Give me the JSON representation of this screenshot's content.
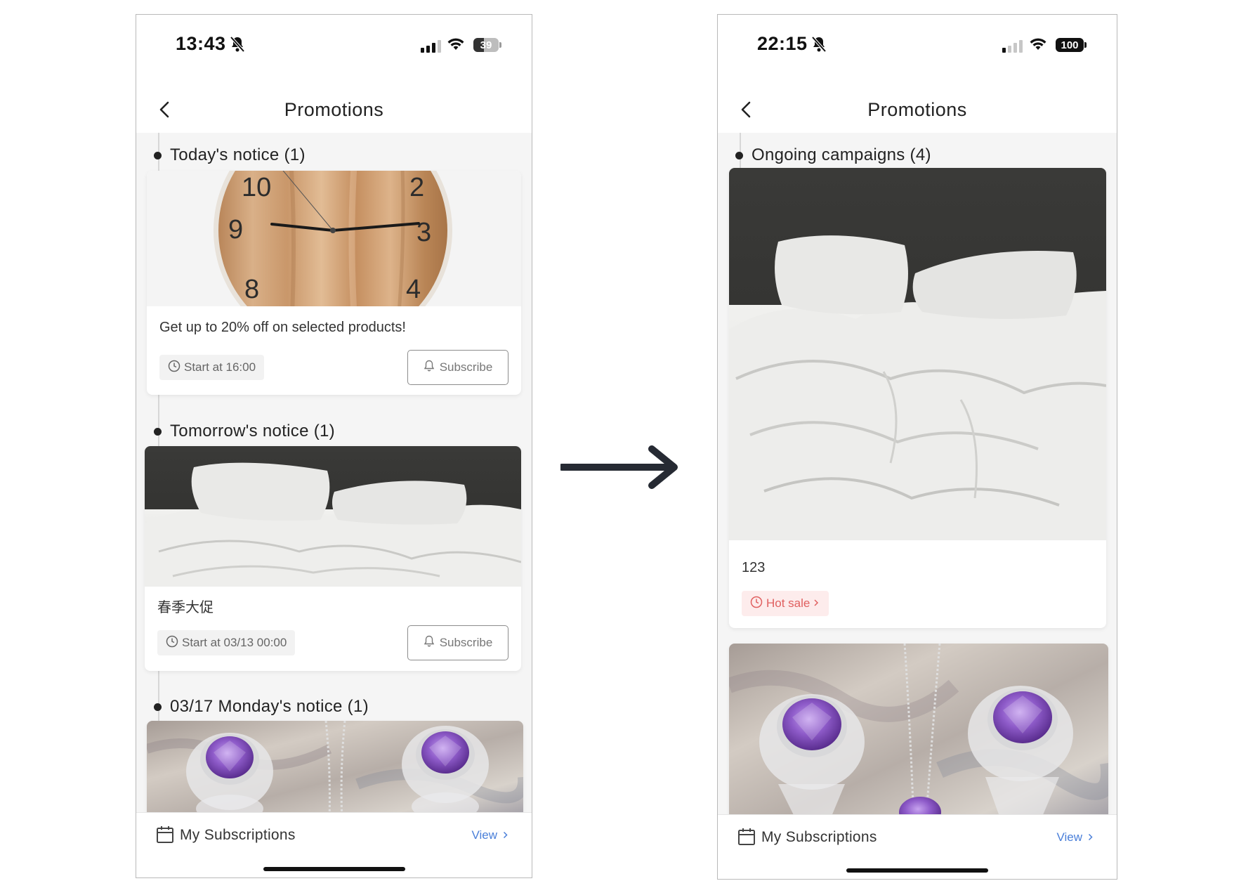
{
  "left_screen": {
    "status": {
      "time": "13:43",
      "battery": "39"
    },
    "nav": {
      "title": "Promotions"
    },
    "sections": [
      {
        "heading": "Today's notice (1)",
        "card": {
          "image": "wall-clock-photo",
          "description": "Get up to 20% off on selected products!",
          "time_label": "Start at 16:00",
          "subscribe_label": "Subscribe"
        }
      },
      {
        "heading": "Tomorrow's notice (1)",
        "card": {
          "image": "white-bed-photo",
          "description": "春季大促",
          "time_label": "Start at 03/13 00:00",
          "subscribe_label": "Subscribe"
        }
      },
      {
        "heading": "03/17 Monday's notice (1)",
        "card": {
          "image": "amethyst-jewelry-photo"
        }
      }
    ],
    "footer": {
      "label": "My Subscriptions",
      "view_label": "View"
    }
  },
  "right_screen": {
    "status": {
      "time": "22:15",
      "battery": "100"
    },
    "nav": {
      "title": "Promotions"
    },
    "sections": [
      {
        "heading": "Ongoing campaigns (4)",
        "cards": [
          {
            "image": "white-bed-photo",
            "description": "123",
            "badge_label": "Hot sale"
          },
          {
            "image": "amethyst-jewelry-photo"
          }
        ]
      }
    ],
    "footer": {
      "label": "My Subscriptions",
      "view_label": "View"
    }
  },
  "colors": {
    "link": "#4a7fd9",
    "hot_sale_text": "#e06060",
    "hot_sale_bg": "#fdecec",
    "page_bg": "#f5f5f5"
  },
  "icons": [
    "bell-off-icon",
    "signal-icon",
    "wifi-icon",
    "battery-icon",
    "back-chevron-icon",
    "clock-icon",
    "bell-icon",
    "calendar-icon",
    "chevron-right-icon",
    "arrow-right-icon"
  ]
}
